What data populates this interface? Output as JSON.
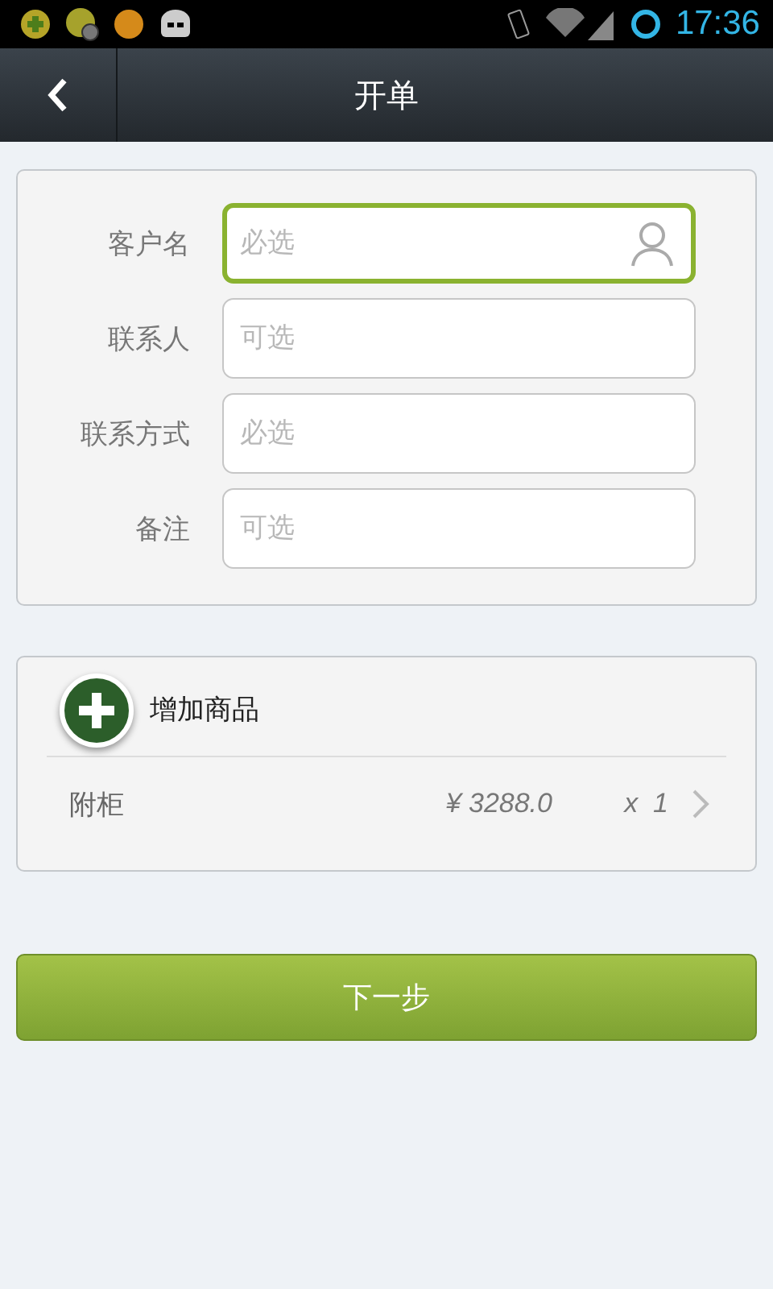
{
  "status_bar": {
    "time": "17:36"
  },
  "app_bar": {
    "title": "开单"
  },
  "form": {
    "fields": [
      {
        "label": "客户名",
        "placeholder": "必选",
        "focused": true,
        "kind": "contact"
      },
      {
        "label": "联系人",
        "placeholder": "可选",
        "focused": false,
        "kind": "text"
      },
      {
        "label": "联系方式",
        "placeholder": "必选",
        "focused": false,
        "kind": "text"
      },
      {
        "label": "备注",
        "placeholder": "可选",
        "focused": false,
        "kind": "text"
      }
    ]
  },
  "products": {
    "add_label": "增加商品",
    "items": [
      {
        "name": "附柜",
        "price": "¥ 3288.0",
        "quantity": "x  1"
      }
    ]
  },
  "next_button": "下一步"
}
